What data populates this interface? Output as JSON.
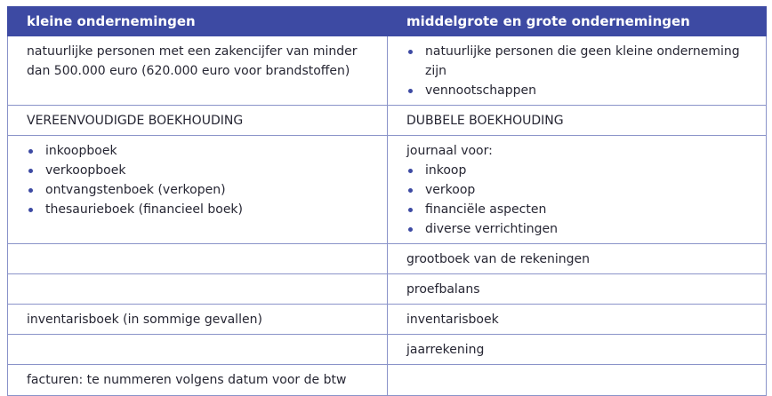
{
  "header": {
    "col1": "kleine ondernemingen",
    "col2": "middelgrote en grote ondernemingen"
  },
  "rows": {
    "r1": {
      "left": "natuurlijke personen met een zakencijfer van minder dan 500.000 euro (620.000 euro voor brandstoffen)",
      "right_items": [
        "natuurlijke personen die geen kleine onderneming zijn",
        "vennootschappen"
      ]
    },
    "r2": {
      "left": "VEREENVOUDIGDE BOEKHOUDING",
      "right": "DUBBELE BOEKHOUDING"
    },
    "r3": {
      "left_items": [
        "inkoopboek",
        "verkoopboek",
        "ontvangstenboek (verkopen)",
        "thesaurieboek (financieel boek)"
      ],
      "right_intro": "journaal voor:",
      "right_items": [
        "inkoop",
        "verkoop",
        "financiële aspecten",
        "diverse verrichtingen"
      ]
    },
    "r4": {
      "left": "",
      "right": "grootboek van de rekeningen"
    },
    "r5": {
      "left": "",
      "right": "proefbalans"
    },
    "r6": {
      "left": "inventarisboek (in sommige gevallen)",
      "right": "inventarisboek"
    },
    "r7": {
      "left": "",
      "right": "jaarrekening"
    },
    "r8": {
      "left": "facturen: te nummeren volgens datum voor de btw",
      "right": ""
    }
  },
  "colors": {
    "header_bg": "#3d4aa3",
    "border": "#8a93c9",
    "bullet": "#3d4aa3"
  }
}
